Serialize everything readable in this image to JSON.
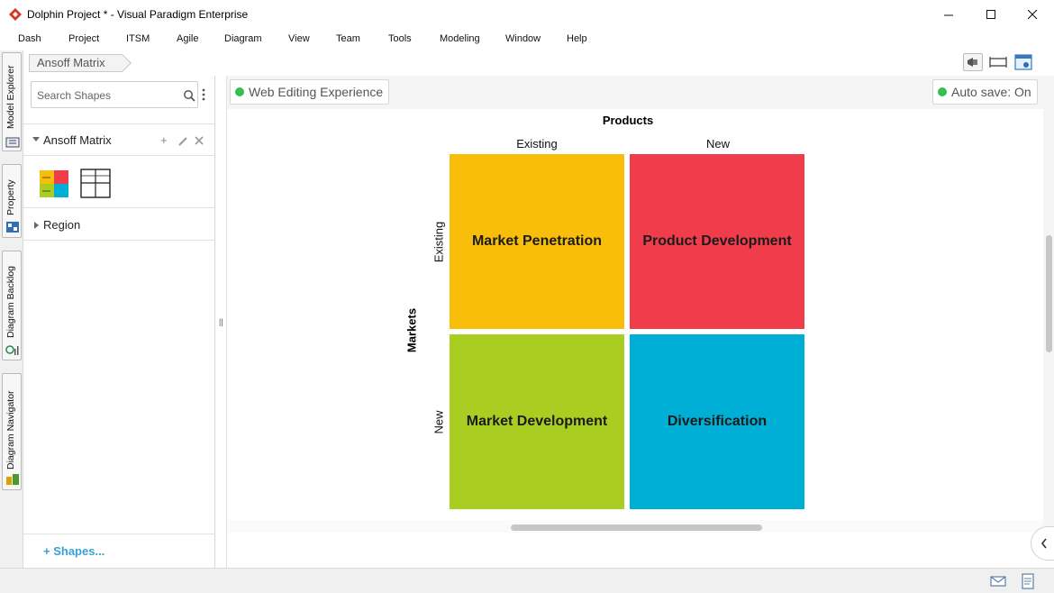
{
  "window": {
    "title": "Dolphin Project * - Visual Paradigm Enterprise",
    "logo": "visual-paradigm-logo",
    "brand_color": "#d9342b"
  },
  "menu": {
    "items": [
      "Dash",
      "Project",
      "ITSM",
      "Agile",
      "Diagram",
      "View",
      "Team",
      "Tools",
      "Modeling",
      "Window",
      "Help"
    ]
  },
  "side_tabs": {
    "items": [
      "Model Explorer",
      "Property",
      "Diagram Backlog",
      "Diagram Navigator"
    ]
  },
  "breadcrumb": {
    "current": "Ansoff Matrix"
  },
  "shapes_panel": {
    "search_placeholder": "Search Shapes",
    "group_label": "Ansoff Matrix",
    "region_label": "Region",
    "more_shapes": "Shapes..."
  },
  "canvas_toolbar": {
    "web_editing": "Web Editing Experience",
    "autosave": "Auto save: On",
    "status_color": "#33c050"
  },
  "ansoff": {
    "x_axis": "Products",
    "y_axis": "Markets",
    "col_existing": "Existing",
    "col_new": "New",
    "row_existing": "Existing",
    "row_new": "New",
    "cells": {
      "market_penetration": {
        "label": "Market Penetration",
        "color": "#f9be09"
      },
      "product_development": {
        "label": "Product Development",
        "color": "#f03c4b"
      },
      "market_development": {
        "label": "Market Development",
        "color": "#aacd22"
      },
      "diversification": {
        "label": "Diversification",
        "color": "#00afd6"
      }
    }
  }
}
